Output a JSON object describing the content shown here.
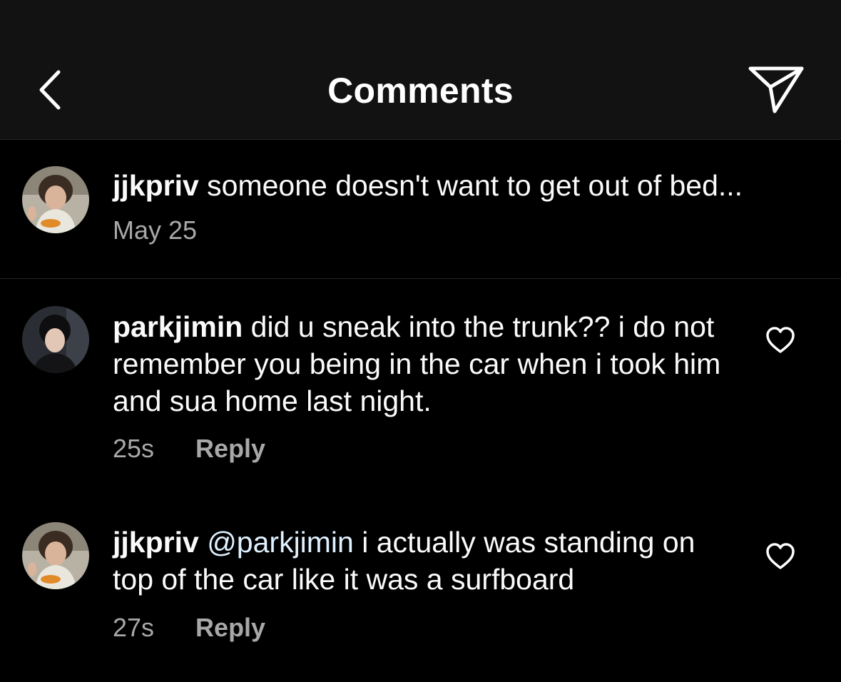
{
  "header": {
    "title": "Comments",
    "back_icon": "chevron-left-icon",
    "send_icon": "paper-plane-icon"
  },
  "caption": {
    "username": "jjkpriv",
    "text": " someone doesn't want to get out of bed...",
    "date": "May 25"
  },
  "comments": [
    {
      "username": "parkjimin",
      "text": " did u sneak into the trunk?? i do not remember you being in the car when i took him and sua home last night.",
      "time": "25s",
      "reply_label": "Reply"
    },
    {
      "username": "jjkpriv",
      "mention": "@parkjimin",
      "text": " i actually was standing on top of the car like it was a surfboard",
      "time": "27s",
      "reply_label": "Reply"
    }
  ],
  "colors": {
    "background": "#000000",
    "header_bg": "#121212",
    "secondary_text": "#a8a8a8",
    "mention": "#e0f1ff"
  }
}
